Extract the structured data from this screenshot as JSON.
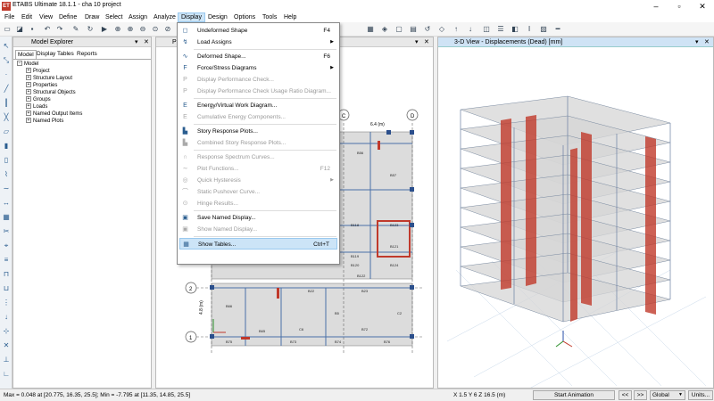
{
  "window": {
    "title": "ETABS Ultimate 18.1.1 - cha 10 project",
    "app_icon": "ET"
  },
  "menu": [
    "File",
    "Edit",
    "View",
    "Define",
    "Draw",
    "Select",
    "Assign",
    "Analyze",
    "Display",
    "Design",
    "Options",
    "Tools",
    "Help"
  ],
  "explorer": {
    "title": "Model Explorer",
    "tabs": [
      "Model",
      "Display",
      "Tables",
      "Reports"
    ],
    "tree_root": "Model",
    "tree_items": [
      "Project",
      "Structure Layout",
      "Properties",
      "Structural Objects",
      "Groups",
      "Loads",
      "Named Output Items",
      "Named Plots"
    ]
  },
  "plan_view": {
    "tab_label": "Pl",
    "grid_bubbles": [
      "C",
      "D",
      "2",
      "1"
    ],
    "dims": [
      "6.4 (m)",
      "4.8 (m)"
    ],
    "labels": [
      "B56",
      "B57",
      "B118",
      "B119",
      "B120",
      "B121",
      "B122",
      "B123",
      "B124",
      "B22",
      "B23",
      "B65",
      "B66",
      "B73",
      "B74",
      "B75",
      "B76",
      "B72",
      "C6",
      "C2",
      "B5"
    ]
  },
  "view3d": {
    "title": "3-D View  - Displacements (Dead)  [mm]"
  },
  "display_menu": {
    "items": [
      {
        "label": "Undeformed Shape",
        "shortcut": "F4",
        "icon": "undeformed-icon",
        "glyph": "◻",
        "enabled": true,
        "submenu": false
      },
      {
        "label": "Load Assigns",
        "shortcut": "",
        "icon": "load-assigns-icon",
        "glyph": "↯",
        "enabled": true,
        "submenu": true
      },
      {
        "label": "Deformed Shape...",
        "shortcut": "F6",
        "icon": "deformed-icon",
        "glyph": "∿",
        "enabled": true,
        "submenu": false
      },
      {
        "label": "Force/Stress Diagrams",
        "shortcut": "",
        "icon": "force-diagram-icon",
        "glyph": "F",
        "enabled": true,
        "submenu": true
      },
      {
        "label": "Display Performance Check...",
        "shortcut": "",
        "icon": "performance-check-icon",
        "glyph": "P",
        "enabled": false,
        "submenu": false
      },
      {
        "label": "Display Performance Check Usage Ratio Diagram...",
        "shortcut": "",
        "icon": "usage-ratio-icon",
        "glyph": "P",
        "enabled": false,
        "submenu": false
      },
      {
        "label": "Energy/Virtual Work Diagram...",
        "shortcut": "",
        "icon": "energy-icon",
        "glyph": "E",
        "enabled": true,
        "submenu": false
      },
      {
        "label": "Cumulative Energy Components...",
        "shortcut": "",
        "icon": "cumulative-energy-icon",
        "glyph": "E",
        "enabled": false,
        "submenu": false
      },
      {
        "label": "Story Response Plots...",
        "shortcut": "",
        "icon": "story-response-icon",
        "glyph": "▙",
        "enabled": true,
        "submenu": false
      },
      {
        "label": "Combined Story Response Plots...",
        "shortcut": "",
        "icon": "combined-story-icon",
        "glyph": "▙",
        "enabled": false,
        "submenu": false
      },
      {
        "label": "Response Spectrum Curves...",
        "shortcut": "",
        "icon": "spectrum-icon",
        "glyph": "∩",
        "enabled": false,
        "submenu": false
      },
      {
        "label": "Plot Functions...",
        "shortcut": "F12",
        "icon": "plot-functions-icon",
        "glyph": "∼",
        "enabled": false,
        "submenu": false
      },
      {
        "label": "Quick Hysteresis",
        "shortcut": "",
        "icon": "hysteresis-icon",
        "glyph": "◎",
        "enabled": false,
        "submenu": true
      },
      {
        "label": "Static Pushover Curve...",
        "shortcut": "",
        "icon": "pushover-icon",
        "glyph": "⌒",
        "enabled": false,
        "submenu": false
      },
      {
        "label": "Hinge Results...",
        "shortcut": "",
        "icon": "hinge-icon",
        "glyph": "⊙",
        "enabled": false,
        "submenu": false
      },
      {
        "label": "Save Named Display...",
        "shortcut": "",
        "icon": "save-display-icon",
        "glyph": "▣",
        "enabled": true,
        "submenu": false
      },
      {
        "label": "Show Named Display...",
        "shortcut": "",
        "icon": "show-display-icon",
        "glyph": "▣",
        "enabled": false,
        "submenu": false
      },
      {
        "label": "Show Tables...",
        "shortcut": "Ctrl+T",
        "icon": "tables-icon",
        "glyph": "▦",
        "enabled": true,
        "submenu": false,
        "highlighted": true
      }
    ]
  },
  "status": {
    "left": "Max = 0.048 at [20.775, 16.35, 25.5];  Min = -7.795 at [11.35, 14.85, 25.5]",
    "coords": "X 1.5  Y 6  Z 16.5 (m)",
    "start_animation": "Start Animation",
    "nav_prev": "<<",
    "nav_next": ">>",
    "coord_system": "Global",
    "units": "Units..."
  },
  "colors": {
    "accent": "#cce4f7",
    "shear_wall": "#c0392b",
    "frame": "#5a7fb0"
  }
}
